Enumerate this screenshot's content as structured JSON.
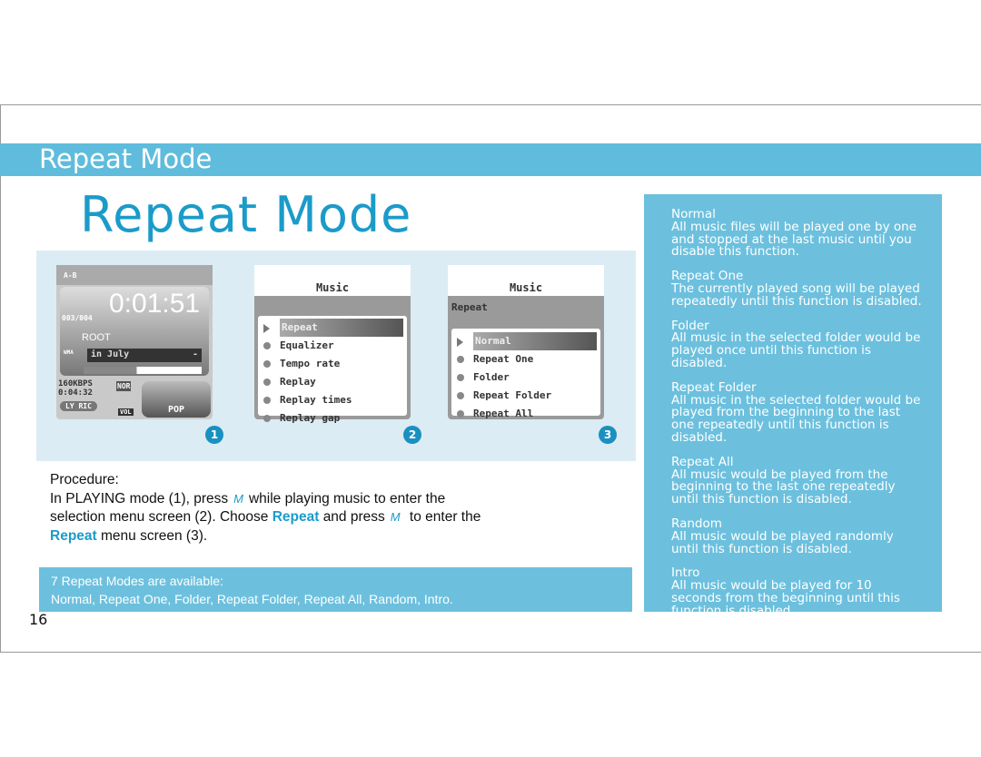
{
  "header": {
    "band_title": "Repeat Mode",
    "title": "Repeat Mode"
  },
  "screen1": {
    "ab": "A-B",
    "time": "0:01:51",
    "track": "003/004",
    "folder": "ROOT",
    "format": "WMA",
    "song": "in July",
    "song_suffix": "-",
    "bitrate": "160KBPS",
    "total": "0:04:32",
    "eq": "NOR",
    "lyric": "LY RIC",
    "vol": "VOL",
    "genre": "POP"
  },
  "screen2": {
    "title": "Music",
    "items": [
      "Repeat",
      "Equalizer",
      "Tempo rate",
      "Replay",
      "Replay times",
      "Replay gap"
    ]
  },
  "screen3": {
    "title": "Music",
    "subtitle": "Repeat",
    "items": [
      "Normal",
      "Repeat One",
      "Folder",
      "Repeat Folder",
      "Repeat All"
    ]
  },
  "steps": [
    "1",
    "2",
    "3"
  ],
  "procedure": {
    "heading": "Procedure:",
    "p1": "In PLAYING mode (1), press",
    "p2": "while playing music to enter the selection menu screen (2). Choose",
    "kw": "Repeat",
    "p3": "and press",
    "p4": "to enter the",
    "p5": "menu screen (3).",
    "m_icon": "M"
  },
  "modes_box": {
    "line1": "7 Repeat Modes are available:",
    "line2": "Normal, Repeat One, Folder, Repeat Folder, Repeat All, Random, Intro."
  },
  "page_number": "16",
  "modes": [
    {
      "name": "Normal",
      "desc": "All music files will be played one by one and stopped at the last music until you disable this function."
    },
    {
      "name": "Repeat One",
      "desc": "The currently played song will be played repeatedly until this function is disabled."
    },
    {
      "name": "Folder",
      "desc": "All music in the selected folder would be played once until this function is disabled."
    },
    {
      "name": "Repeat Folder",
      "desc": "All music in the selected folder would be played from the beginning to the last one repeatedly until this function is disabled."
    },
    {
      "name": "Repeat All",
      "desc": "All music would be played from the beginning to the last one repeatedly until this function is disabled."
    },
    {
      "name": "Random",
      "desc": "All music would be played randomly until this function is disabled."
    },
    {
      "name": "Intro",
      "desc": "All music would be played for 10 seconds from the beginning until this function is disabled."
    }
  ]
}
